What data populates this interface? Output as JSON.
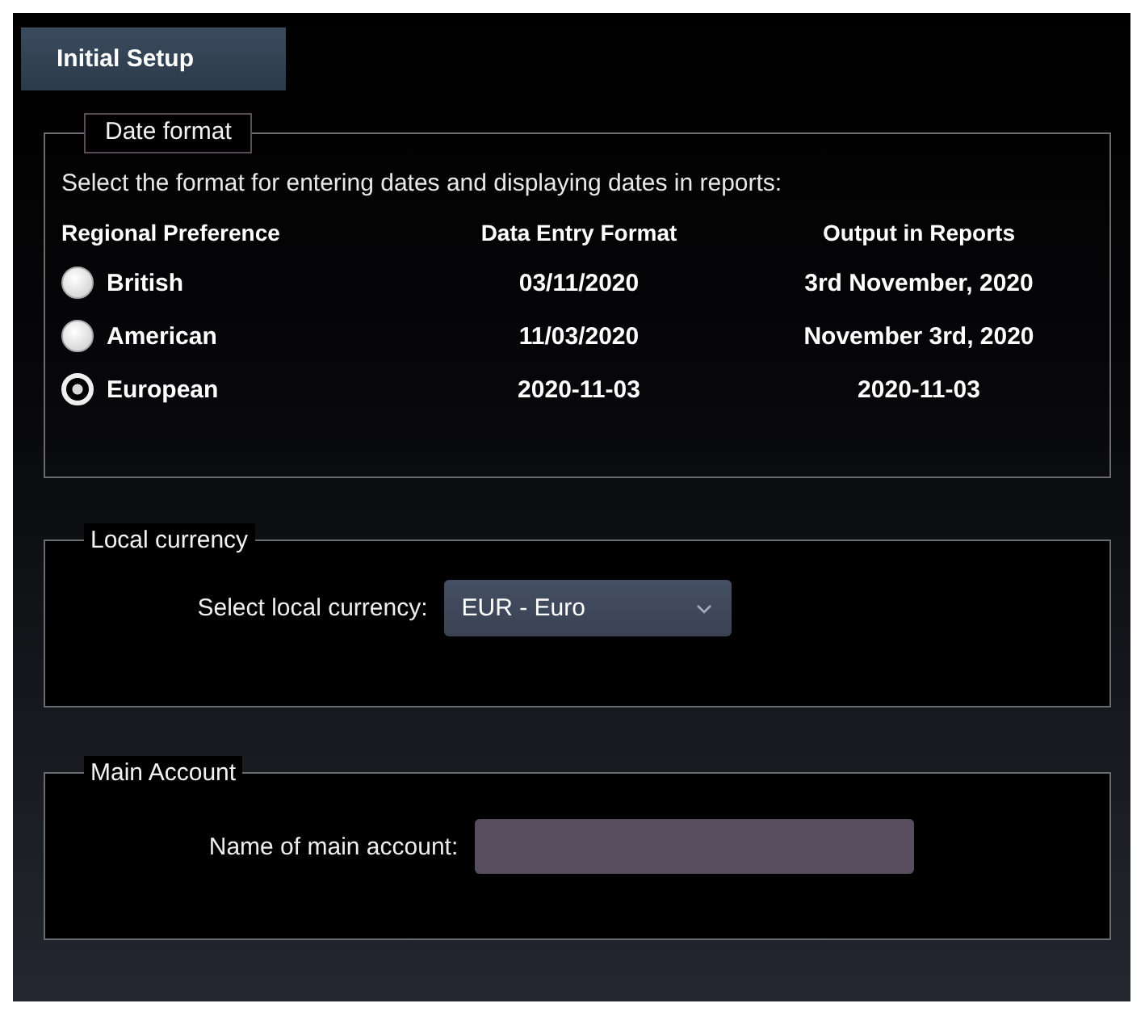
{
  "tabs": [
    {
      "label": "Initial Setup",
      "selected": true
    }
  ],
  "date_format": {
    "title": "Date format",
    "instruction": "Select the format for entering dates and displaying dates in reports:",
    "columns": [
      "Regional Preference",
      "Data Entry Format",
      "Output in Reports"
    ],
    "rows": [
      {
        "name": "British",
        "entry": "03/11/2020",
        "output": "3rd November, 2020",
        "selected": false
      },
      {
        "name": "American",
        "entry": "11/03/2020",
        "output": "November 3rd, 2020",
        "selected": false
      },
      {
        "name": "European",
        "entry": "2020-11-03",
        "output": "2020-11-03",
        "selected": true
      }
    ]
  },
  "local_currency": {
    "title": "Local currency",
    "label": "Select local currency:",
    "value": "EUR - Euro"
  },
  "main_account": {
    "title": "Main Account",
    "label": "Name of main account:"
  }
}
